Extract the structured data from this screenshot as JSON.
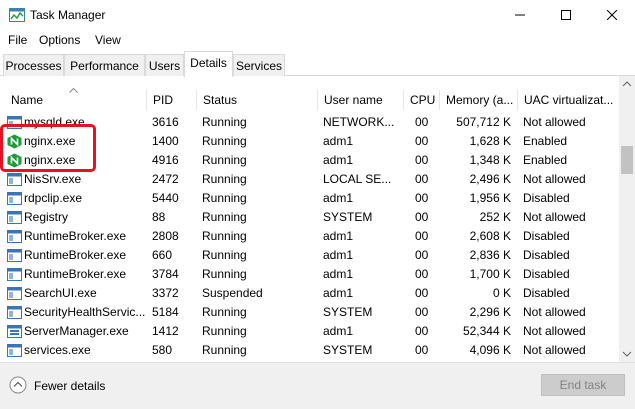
{
  "window": {
    "title": "Task Manager"
  },
  "menu": [
    "File",
    "Options",
    "View"
  ],
  "tabs": [
    "Processes",
    "Performance",
    "Users",
    "Details",
    "Services"
  ],
  "active_tab": "Details",
  "columns": [
    "Name",
    "PID",
    "Status",
    "User name",
    "CPU",
    "Memory (a...",
    "UAC virtualizat..."
  ],
  "rows": [
    {
      "name": "mysqld.exe",
      "pid": "3616",
      "status": "Running",
      "user": "NETWORK...",
      "cpu": "00",
      "memory": "507,712 K",
      "uac": "Not allowed",
      "icon": "app-window-icon"
    },
    {
      "name": "nginx.exe",
      "pid": "1400",
      "status": "Running",
      "user": "adm1",
      "cpu": "00",
      "memory": "1,628 K",
      "uac": "Enabled",
      "icon": "nginx-icon"
    },
    {
      "name": "nginx.exe",
      "pid": "4916",
      "status": "Running",
      "user": "adm1",
      "cpu": "00",
      "memory": "1,348 K",
      "uac": "Enabled",
      "icon": "nginx-icon"
    },
    {
      "name": "NisSrv.exe",
      "pid": "2472",
      "status": "Running",
      "user": "LOCAL SE...",
      "cpu": "00",
      "memory": "2,496 K",
      "uac": "Not allowed",
      "icon": "app-window-icon"
    },
    {
      "name": "rdpclip.exe",
      "pid": "5440",
      "status": "Running",
      "user": "adm1",
      "cpu": "00",
      "memory": "1,956 K",
      "uac": "Disabled",
      "icon": "app-window-icon"
    },
    {
      "name": "Registry",
      "pid": "88",
      "status": "Running",
      "user": "SYSTEM",
      "cpu": "00",
      "memory": "252 K",
      "uac": "Not allowed",
      "icon": "app-window-icon"
    },
    {
      "name": "RuntimeBroker.exe",
      "pid": "2808",
      "status": "Running",
      "user": "adm1",
      "cpu": "00",
      "memory": "2,608 K",
      "uac": "Disabled",
      "icon": "app-window-icon"
    },
    {
      "name": "RuntimeBroker.exe",
      "pid": "660",
      "status": "Running",
      "user": "adm1",
      "cpu": "00",
      "memory": "2,836 K",
      "uac": "Disabled",
      "icon": "app-window-icon"
    },
    {
      "name": "RuntimeBroker.exe",
      "pid": "3784",
      "status": "Running",
      "user": "adm1",
      "cpu": "00",
      "memory": "1,700 K",
      "uac": "Disabled",
      "icon": "app-window-icon"
    },
    {
      "name": "SearchUI.exe",
      "pid": "3372",
      "status": "Suspended",
      "user": "adm1",
      "cpu": "00",
      "memory": "0 K",
      "uac": "Disabled",
      "icon": "app-window-icon"
    },
    {
      "name": "SecurityHealthServic...",
      "pid": "5184",
      "status": "Running",
      "user": "SYSTEM",
      "cpu": "00",
      "memory": "2,296 K",
      "uac": "Not allowed",
      "icon": "app-window-icon"
    },
    {
      "name": "ServerManager.exe",
      "pid": "1412",
      "status": "Running",
      "user": "adm1",
      "cpu": "00",
      "memory": "52,344 K",
      "uac": "Not allowed",
      "icon": "server-manager-icon"
    },
    {
      "name": "services.exe",
      "pid": "580",
      "status": "Running",
      "user": "SYSTEM",
      "cpu": "00",
      "memory": "4,096 K",
      "uac": "Not allowed",
      "icon": "app-window-icon"
    }
  ],
  "footer": {
    "fewer_details": "Fewer details",
    "end_task": "End task"
  }
}
